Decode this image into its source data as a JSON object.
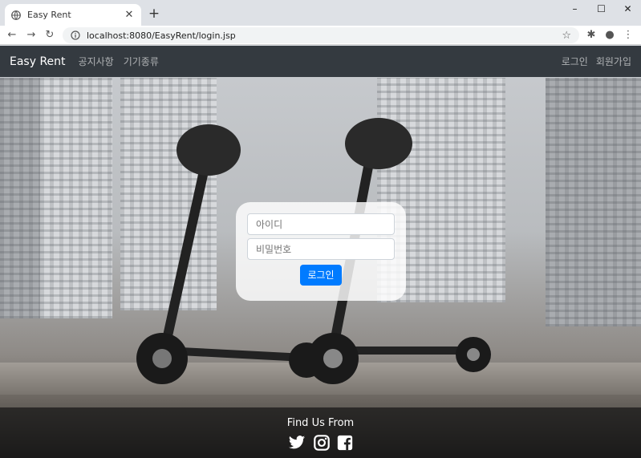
{
  "browser": {
    "tab_title": "Easy Rent",
    "new_tab": "+",
    "url": "localhost:8080/EasyRent/login.jsp",
    "window_controls": {
      "minimize": "–",
      "maximize": "☐",
      "close": "✕"
    },
    "nav": {
      "back": "←",
      "forward": "→",
      "reload": "↻"
    }
  },
  "navbar": {
    "brand": "Easy Rent",
    "links": [
      "공지사항",
      "기기종류"
    ],
    "right_links": [
      "로그인",
      "회원가입"
    ]
  },
  "login": {
    "id_placeholder": "아이디",
    "password_placeholder": "비밀번호",
    "submit_label": "로그인"
  },
  "footer": {
    "title": "Find Us From",
    "social_icons": [
      "twitter-icon",
      "instagram-icon",
      "facebook-icon"
    ]
  },
  "colors": {
    "navbar_bg": "#343a40",
    "button_primary": "#007bff"
  }
}
